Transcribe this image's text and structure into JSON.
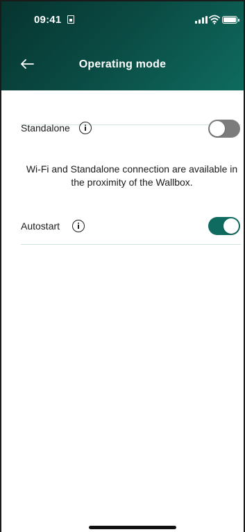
{
  "status_bar": {
    "time": "09:41"
  },
  "header": {
    "title": "Operating mode"
  },
  "settings": [
    {
      "label": "Standalone",
      "enabled": false
    },
    {
      "label": "Autostart",
      "enabled": true
    }
  ],
  "note": "Wi-Fi and Standalone connection are available in the proximity of the Wallbox.",
  "colors": {
    "header_gradient_start": "#07342f",
    "header_gradient_end": "#0f6b5f",
    "toggle_on": "#0f6b5f",
    "toggle_off": "#7c7c7c",
    "divider": "#cfe3df"
  },
  "icons": {
    "back": "arrow-left-icon",
    "info": "info-icon",
    "sim": "sim-card-icon",
    "signal": "cellular-signal-icon",
    "wifi": "wifi-icon",
    "battery": "battery-icon"
  }
}
